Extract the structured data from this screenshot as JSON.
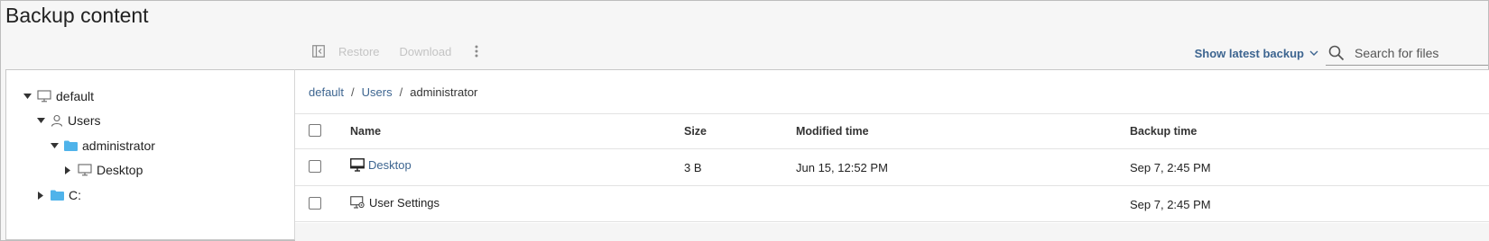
{
  "page": {
    "title": "Backup content"
  },
  "toolbar": {
    "restore_label": "Restore",
    "download_label": "Download",
    "latest_label": "Show latest backup",
    "search_placeholder": "Search for files",
    "search_value": ""
  },
  "tree": {
    "nodes": [
      {
        "label": "default",
        "icon": "computer-icon",
        "expanded": true
      },
      {
        "label": "Users",
        "icon": "user-icon",
        "expanded": true
      },
      {
        "label": "administrator",
        "icon": "folder-icon",
        "expanded": true
      },
      {
        "label": "Desktop",
        "icon": "computer-icon",
        "expanded": false
      },
      {
        "label": "C:",
        "icon": "folder-icon",
        "expanded": false
      }
    ]
  },
  "breadcrumb": {
    "items": [
      "default",
      "Users",
      "administrator"
    ],
    "separator": "/"
  },
  "table": {
    "columns": [
      "Name",
      "Size",
      "Modified time",
      "Backup time"
    ],
    "rows": [
      {
        "name": "Desktop",
        "icon": "monitor-icon",
        "size": "3 B",
        "modified": "Jun 15, 12:52 PM",
        "backup": "Sep 7, 2:45 PM"
      },
      {
        "name": "User Settings",
        "icon": "settings-monitor-icon",
        "size": "",
        "modified": "",
        "backup": "Sep 7, 2:45 PM"
      }
    ]
  },
  "colors": {
    "link": "#3d6590",
    "folder": "#4fb3ea",
    "disabled": "#c4c4c4"
  }
}
